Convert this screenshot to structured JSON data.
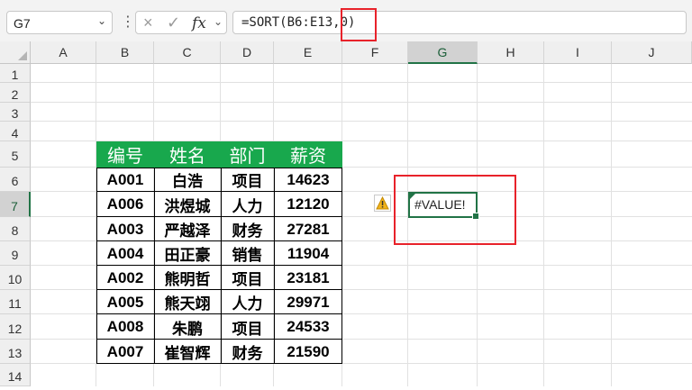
{
  "formula_bar": {
    "name_box": "G7",
    "cancel_icon": "×",
    "enter_icon": "✓",
    "fx_label": "fx",
    "formula": "=SORT(B6:E13,0)"
  },
  "columns": [
    "A",
    "B",
    "C",
    "D",
    "E",
    "F",
    "G",
    "H",
    "I",
    "J"
  ],
  "rows": [
    "1",
    "2",
    "3",
    "4",
    "5",
    "6",
    "7",
    "8",
    "9",
    "10",
    "11",
    "12",
    "13",
    "14"
  ],
  "selected_cell": "G7",
  "table": {
    "headers": [
      "编号",
      "姓名",
      "部门",
      "薪资"
    ],
    "rows": [
      [
        "A001",
        "白浩",
        "项目",
        "14623"
      ],
      [
        "A006",
        "洪煜城",
        "人力",
        "12120"
      ],
      [
        "A003",
        "严越泽",
        "财务",
        "27281"
      ],
      [
        "A004",
        "田正豪",
        "销售",
        "11904"
      ],
      [
        "A002",
        "熊明哲",
        "项目",
        "23181"
      ],
      [
        "A005",
        "熊天翊",
        "人力",
        "29971"
      ],
      [
        "A008",
        "朱鹏",
        "项目",
        "24533"
      ],
      [
        "A007",
        "崔智辉",
        "财务",
        "21590"
      ]
    ]
  },
  "result_cell": "#VALUE!",
  "colors": {
    "header_green": "#18a84d",
    "selection_green": "#217346",
    "highlight_red": "#e8222a"
  }
}
